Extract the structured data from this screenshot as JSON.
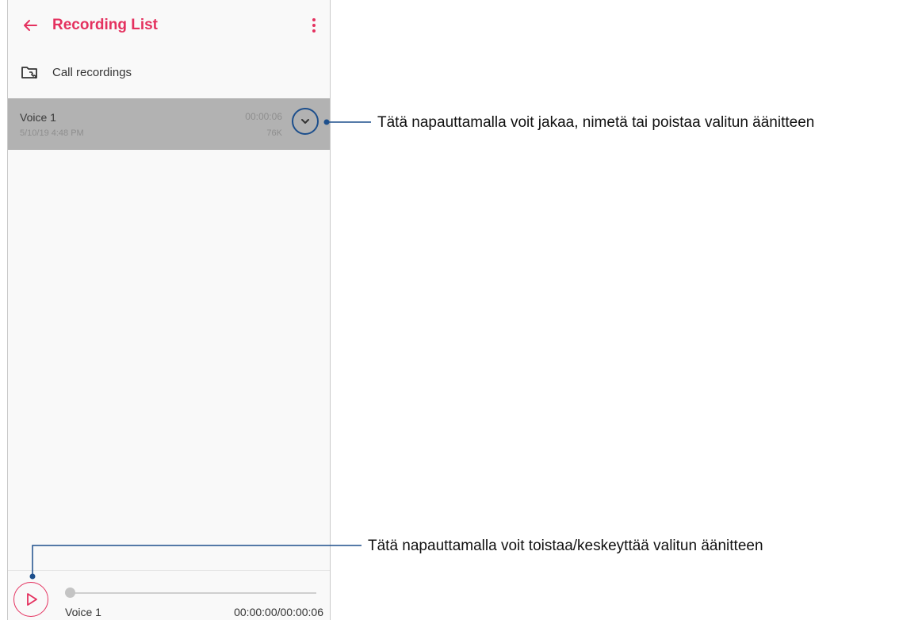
{
  "appbar": {
    "title": "Recording List",
    "back_icon": "arrow-left-icon",
    "menu_icon": "more-vertical-icon"
  },
  "folder": {
    "label": "Call recordings",
    "icon": "folder-call-icon"
  },
  "recording": {
    "name": "Voice 1",
    "date": "5/10/19 4:48 PM",
    "duration": "00:00:06",
    "size": "76K",
    "expand_icon": "chevron-down-icon"
  },
  "player": {
    "name": "Voice 1",
    "time": "00:00:00/00:00:06",
    "progress": 0,
    "play_icon": "play-icon"
  },
  "annotations": {
    "expand": "Tätä napauttamalla voit jakaa, nimetä tai poistaa valitun äänitteen",
    "play": "Tätä napauttamalla voit toistaa/keskeyttää valitun äänitteen"
  },
  "colors": {
    "accent": "#e4315f",
    "callout": "#1d4f8c",
    "selected_row": "#b2b2b2"
  }
}
